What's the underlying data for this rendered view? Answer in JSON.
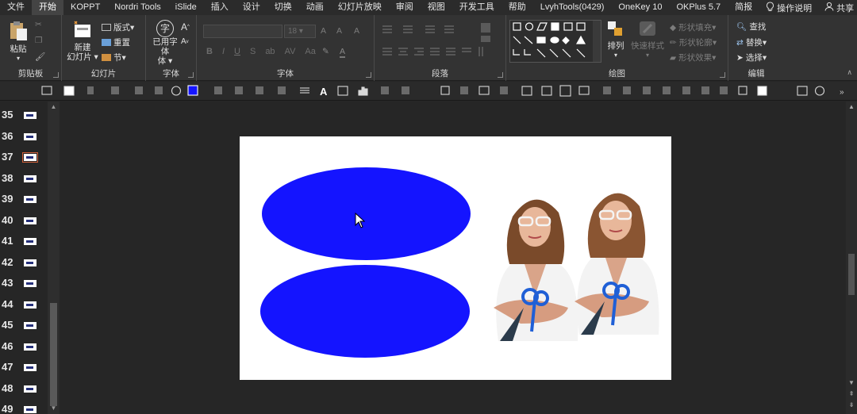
{
  "menubar": {
    "tabs": [
      "文件",
      "开始",
      "KOPPT",
      "Nordri Tools",
      "iSlide",
      "插入",
      "设计",
      "切换",
      "动画",
      "幻灯片放映",
      "审阅",
      "视图",
      "开发工具",
      "帮助",
      "LvyhTools(0429)",
      "OneKey 10",
      "OKPlus 5.7",
      "简报"
    ],
    "active_tab": "开始",
    "tell_me": "操作说明",
    "share": "共享"
  },
  "ribbon": {
    "clipboard": {
      "label": "剪贴板",
      "paste": "粘贴"
    },
    "slides": {
      "label": "幻灯片",
      "new_slide_line1": "新建",
      "new_slide_line2": "幻灯片",
      "layout": "版式",
      "reset": "重置",
      "section": "节"
    },
    "font_used": {
      "label": "字体",
      "btn_line1": "已用字体",
      "btn_line2": "体",
      "glyph": "字"
    },
    "font": {
      "label": "字体",
      "size_value": "18"
    },
    "paragraph": {
      "label": "段落"
    },
    "drawing": {
      "label": "绘图",
      "arrange": "排列",
      "quick_styles": "快速样式",
      "shape_fill": "形状填充",
      "shape_outline": "形状轮廓",
      "shape_effects": "形状效果"
    },
    "editing": {
      "label": "编辑",
      "find": "查找",
      "replace": "替换",
      "select": "选择"
    }
  },
  "thumbnails": {
    "numbers": [
      "35",
      "36",
      "37",
      "38",
      "39",
      "40",
      "41",
      "42",
      "43",
      "44",
      "45",
      "46",
      "47",
      "48",
      "49"
    ],
    "selected": "37"
  },
  "slide": {
    "shape_color": "#1414ff",
    "shapes": [
      "ellipse",
      "ellipse"
    ],
    "images": [
      "doctor-woman-photo",
      "doctor-woman-photo"
    ]
  },
  "colors": {
    "background": "#262626",
    "ribbon": "#333333",
    "active_tab": "#444444"
  }
}
